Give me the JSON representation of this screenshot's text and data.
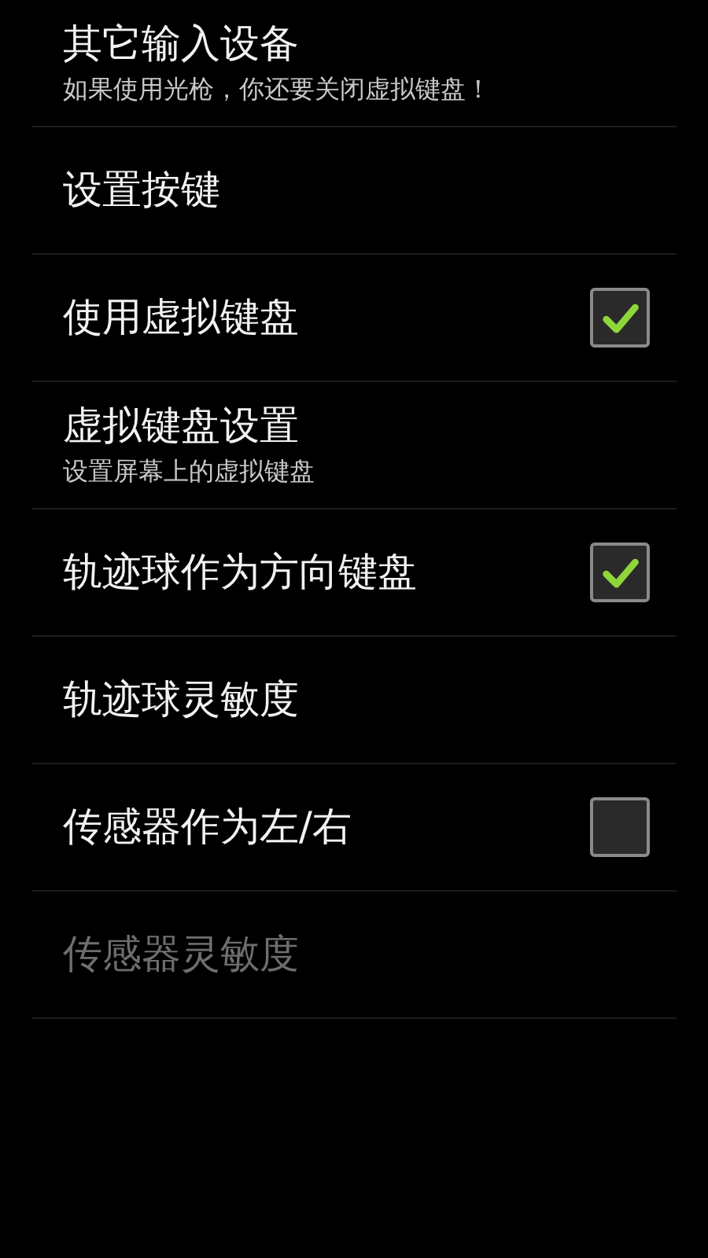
{
  "preferences": [
    {
      "kind": "text",
      "title": "其它输入设备",
      "summary": "如果使用光枪，你还要关闭虚拟键盘！",
      "disabled": false
    },
    {
      "kind": "text",
      "title": "设置按键",
      "disabled": false
    },
    {
      "kind": "checkbox",
      "title": "使用虚拟键盘",
      "checked": true,
      "disabled": false
    },
    {
      "kind": "text",
      "title": "虚拟键盘设置",
      "summary": "设置屏幕上的虚拟键盘",
      "disabled": false
    },
    {
      "kind": "checkbox",
      "title": "轨迹球作为方向键盘",
      "checked": true,
      "disabled": false
    },
    {
      "kind": "text",
      "title": "轨迹球灵敏度",
      "disabled": false
    },
    {
      "kind": "checkbox",
      "title": "传感器作为左/右",
      "checked": false,
      "disabled": false
    },
    {
      "kind": "text",
      "title": "传感器灵敏度",
      "disabled": true
    }
  ]
}
